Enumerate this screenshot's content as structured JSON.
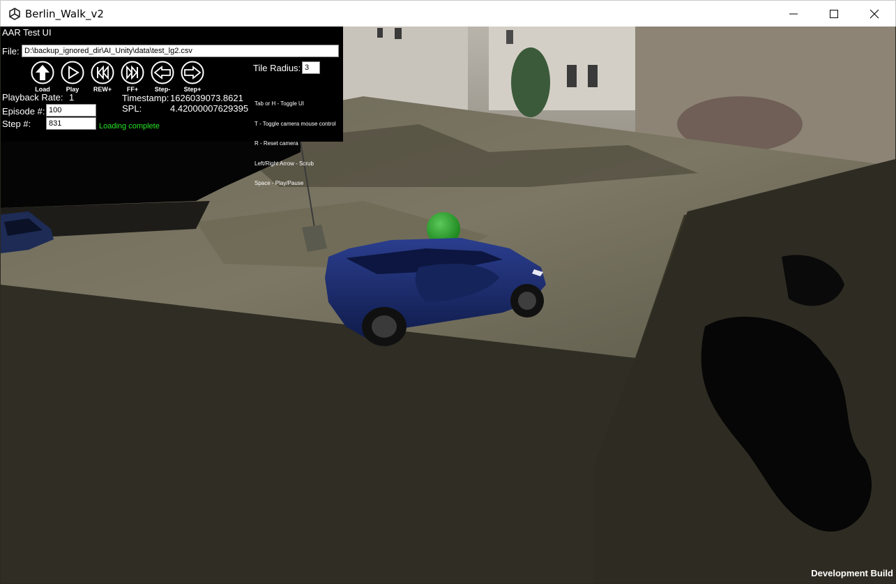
{
  "window": {
    "title": "Berlin_Walk_v2"
  },
  "hud": {
    "title": "AAR Test UI",
    "file_label": "File:",
    "file_value": "D:\\backup_ignored_dir\\AI_Unity\\data\\test_lg2.csv",
    "tile_radius_label": "Tile Radius:",
    "tile_radius_value": "3",
    "buttons": [
      {
        "label": "Load",
        "icon": "arrow-up-icon"
      },
      {
        "label": "Play",
        "icon": "play-icon"
      },
      {
        "label": "REW+",
        "icon": "rewind-icon"
      },
      {
        "label": "FF+",
        "icon": "fast-forward-icon"
      },
      {
        "label": "Step-",
        "icon": "arrow-left-icon"
      },
      {
        "label": "Step+",
        "icon": "arrow-right-icon"
      }
    ],
    "playback_rate_label": "Playback Rate:",
    "playback_rate_value": "1",
    "timestamp_label": "Timestamp:",
    "timestamp_value": "1626039073.8621",
    "spl_label": "SPL:",
    "spl_value": "4.42000007629395",
    "episode_label": "Episode #:",
    "episode_value": "100",
    "step_label": "Step #:",
    "step_value": "831",
    "status": "Loading complete",
    "help_lines": [
      "Tab or H - Toggle UI",
      "T - Toggle camera mouse control",
      "R - Reset camera",
      "Left/Right Arrow - Scrub",
      "Space - Play/Pause"
    ]
  },
  "footer": {
    "build_label": "Development Build"
  }
}
